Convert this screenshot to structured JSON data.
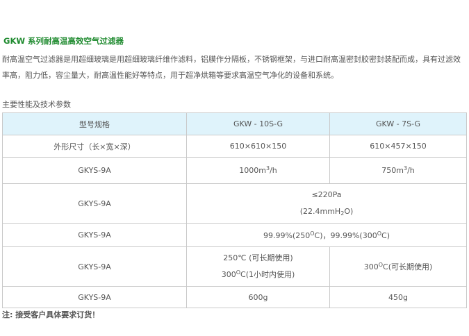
{
  "header": {
    "title": "GKW 系列耐高温高效空气过滤器"
  },
  "intro": "耐高温空气过滤器是用超细玻璃是用超细玻璃纤维作滤料，铝膜作分隔板，不锈钢框架，与进口耐高温密封胶密封装配而成，具有过滤效率高，阻力低，容尘量大，耐高温性能好等特点，用于超净烘箱等要求高温空气净化的设备和系统。",
  "section_title": "主要性能及技术参数",
  "table": {
    "headers": [
      "型号规格",
      "GKW - 10S-G",
      "GKW - 7S-G"
    ],
    "size_label": "外形尺寸（长×宽×深）",
    "size_10s": "610×610×150",
    "size_7s": "610×457×150",
    "airflow_label": "GKYS-9A",
    "airflow_10s_num": "1000m",
    "airflow_10s_sup": "3",
    "airflow_10s_unit": "/h",
    "airflow_7s_num": "750m",
    "airflow_7s_sup": "3",
    "airflow_7s_unit": "/h",
    "resistance_label": "GKYS-9A",
    "resistance_line1": "≤220Pa",
    "resistance_line2_a": "(22.4mmH",
    "resistance_line2_sub": "2",
    "resistance_line2_b": "O)",
    "efficiency_label": "GKYS-9A",
    "efficiency_a": "99.99%(250",
    "efficiency_sup1": "O",
    "efficiency_b": "C)，99.99%(300",
    "efficiency_sup2": "O",
    "efficiency_c": "C)",
    "temp_label": "GKYS-9A",
    "temp_10s_line1": "250℃ (可长期使用)",
    "temp_10s_line2_a": "300",
    "temp_10s_line2_sup": "O",
    "temp_10s_line2_b": "C(1小时内使用)",
    "temp_7s_a": "300",
    "temp_7s_sup": "O",
    "temp_7s_b": "C(可长期使用)",
    "weight_label": "GKYS-9A",
    "weight_10s": "600g",
    "weight_7s": "450g"
  },
  "note": "注: 接受客户具体要求订货！"
}
